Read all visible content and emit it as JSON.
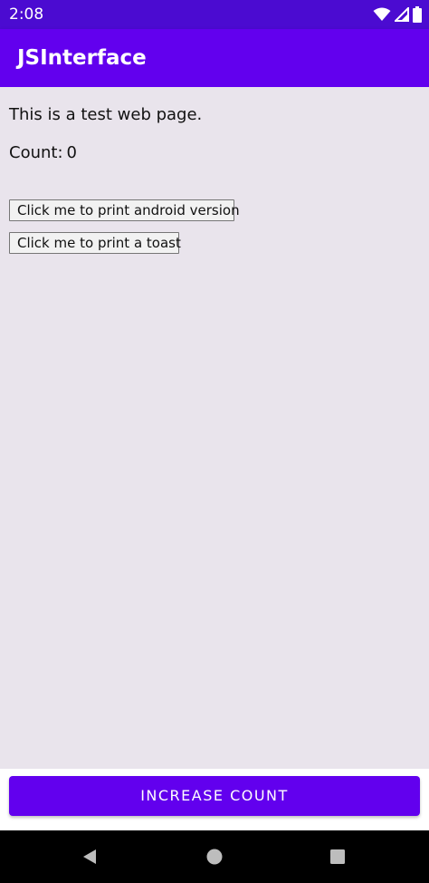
{
  "status_bar": {
    "time": "2:08",
    "icons": [
      "wifi-icon",
      "signal-icon",
      "battery-icon"
    ]
  },
  "app_bar": {
    "title": "JSInterface"
  },
  "webview": {
    "heading": "This is a test web page.",
    "count_label": "Count:",
    "count_value": "0",
    "buttons": [
      {
        "label": "Click me to print android version"
      },
      {
        "label": "Click me to print a toast"
      }
    ]
  },
  "bottom": {
    "increase_label": "INCREASE COUNT"
  },
  "nav_bar": {
    "icons": [
      "back-icon",
      "home-icon",
      "recents-icon"
    ]
  },
  "colors": {
    "status_bar": "#4b0bd1",
    "primary": "#6200ee",
    "background": "#e9e4ec"
  }
}
